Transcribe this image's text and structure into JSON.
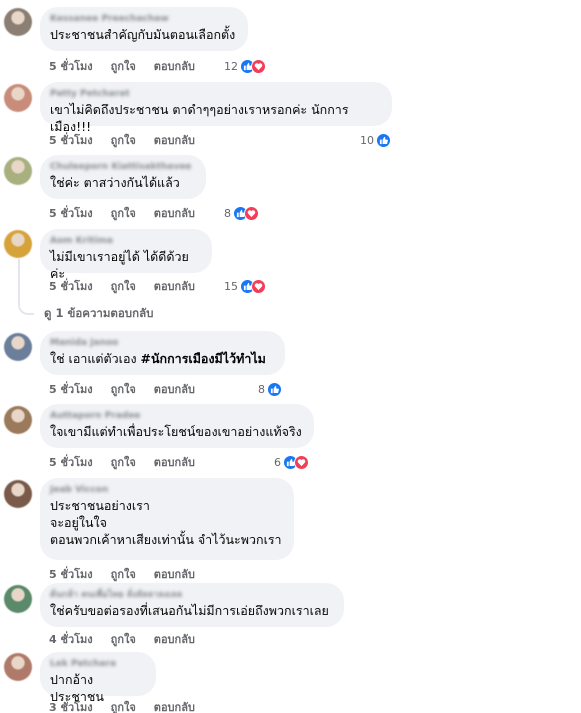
{
  "ui": {
    "colors": {
      "like": "#1877f2",
      "love": "#f33e58",
      "bubble": "#f0f2f5",
      "meta": "#65676b"
    }
  },
  "comments": [
    {
      "author": "Kessanee Preechachaw",
      "text": "ประชาชนสำคัญกับมันตอนเลือกตั้ง",
      "time": "5 ชั่วโมง",
      "like_label": "ถูกใจ",
      "reply_label": "ตอบกลับ",
      "reaction_count": "12",
      "reactions": [
        "like-icon",
        "love-icon"
      ],
      "avatar_color": "#8a7f72"
    },
    {
      "author": "Patty Petcharat",
      "text": "เขาไม่คิดถึงประชาชน ตาดำๆๆอย่างเราหรอกค่ะ นักการเมือง!!!",
      "time": "5 ชั่วโมง",
      "like_label": "ถูกใจ",
      "reply_label": "ตอบกลับ",
      "reaction_count": "10",
      "reactions": [
        "like-icon"
      ],
      "avatar_color": "#c98c7a"
    },
    {
      "author": "Chuleeporn Kiattisakthavee",
      "text": "ใช่ค่ะ ตาสว่างกันได้แล้ว",
      "time": "5 ชั่วโมง",
      "like_label": "ถูกใจ",
      "reply_label": "ตอบกลับ",
      "reaction_count": "8",
      "reactions": [
        "like-icon",
        "love-icon"
      ],
      "avatar_color": "#a8b080"
    },
    {
      "author": "Aom Kritima",
      "text": "ไม่มีเขาเราอยู่ได้ ได้ดีด้วยค่ะ",
      "time": "5 ชั่วโมง",
      "like_label": "ถูกใจ",
      "reply_label": "ตอบกลับ",
      "reaction_count": "15",
      "reactions": [
        "like-icon",
        "love-icon"
      ],
      "avatar_color": "#d6a23a"
    },
    {
      "author": "Manida Janoo",
      "text_plain": "ใช่ เอาแต่ตัวเอง ",
      "text_bold": "#นักการเมืองมีไว้ทำไม",
      "time": "5 ชั่วโมง",
      "like_label": "ถูกใจ",
      "reply_label": "ตอบกลับ",
      "reaction_count": "8",
      "reactions": [
        "like-icon"
      ],
      "avatar_color": "#6b7f9a"
    },
    {
      "author": "Auttaporn Pradee",
      "text": "ใจเขามีแต่ทำเพื่อประโยชน์ของเขาอย่างแท้จริง",
      "time": "5 ชั่วโมง",
      "like_label": "ถูกใจ",
      "reply_label": "ตอบกลับ",
      "reaction_count": "6",
      "reactions": [
        "like-icon",
        "love-icon"
      ],
      "avatar_color": "#9a7a5a"
    },
    {
      "author": "Jeab Viccon",
      "text": "ประชาชนอย่างเรา\nจะอยู่ในใจ\nตอนพวกเค้าหาเสียงเท่านั้น จำไว้นะพวกเรา",
      "time": "5 ชั่วโมง",
      "like_label": "ถูกใจ",
      "reply_label": "ตอบกลับ",
      "avatar_color": "#7a5a4a"
    },
    {
      "author": "ต้นกล้า คนเพื่อไทย ลั่งลัลลาลงเลล",
      "text": "ใช่ครับขอต่อรองที่เสนอกันไม่มีการเอ่ยถึงพวกเราเลย",
      "time": "4 ชั่วโมง",
      "like_label": "ถูกใจ",
      "reply_label": "ตอบกลับ",
      "avatar_color": "#5a8a6a"
    },
    {
      "author": "Lek Patchara",
      "text": "ปากอ้างประชาชน",
      "time": "3 ชั่วโมง",
      "like_label": "ถูกใจ",
      "reply_label": "ตอบกลับ",
      "avatar_color": "#b07a6a"
    }
  ],
  "thread": {
    "view_replies": "ดู 1 ข้อความตอบกลับ"
  }
}
